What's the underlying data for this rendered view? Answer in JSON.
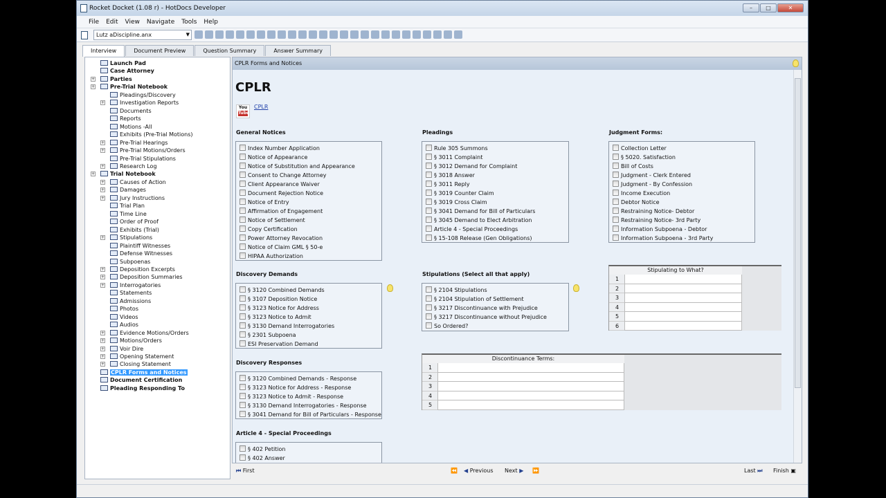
{
  "window": {
    "title": "Rocket Docket (1.08 r)  - HotDocs Developer"
  },
  "menu": [
    "File",
    "Edit",
    "View",
    "Navigate",
    "Tools",
    "Help"
  ],
  "toolbar": {
    "document": "Lutz aDiscipline.anx"
  },
  "tabs": [
    "Interview",
    "Document Preview",
    "Question Summary",
    "Answer Summary"
  ],
  "tree": [
    {
      "label": "Launch Pad",
      "level": 0,
      "bold": true
    },
    {
      "label": "Case Attorney",
      "level": 0,
      "bold": true
    },
    {
      "label": "Parties",
      "level": 0,
      "bold": true,
      "expand": true
    },
    {
      "label": "Pre-Trial Notebook",
      "level": 0,
      "bold": true,
      "expand": true
    },
    {
      "label": "Pleadings/Discovery",
      "level": 1
    },
    {
      "label": "Investigation Reports",
      "level": 1,
      "expand": true
    },
    {
      "label": "Documents",
      "level": 1
    },
    {
      "label": "Reports",
      "level": 1
    },
    {
      "label": "Motions -All",
      "level": 1
    },
    {
      "label": "Exhibits   (Pre-Trial Motions)",
      "level": 1
    },
    {
      "label": "Pre-Trial Hearings",
      "level": 1,
      "expand": true
    },
    {
      "label": "Pre-Trial Motions/Orders",
      "level": 1,
      "expand": true
    },
    {
      "label": "Pre-Trial Stipulations",
      "level": 1
    },
    {
      "label": "Research Log",
      "level": 1,
      "expand": true
    },
    {
      "label": "Trial Notebook",
      "level": 0,
      "bold": true,
      "expand": true
    },
    {
      "label": "Causes of Action",
      "level": 1,
      "expand": true
    },
    {
      "label": "Damages",
      "level": 1,
      "expand": true
    },
    {
      "label": "Jury Instructions",
      "level": 1,
      "expand": true
    },
    {
      "label": "Trial Plan",
      "level": 1
    },
    {
      "label": "Time Line",
      "level": 1
    },
    {
      "label": "Order of Proof",
      "level": 1
    },
    {
      "label": "Exhibits (Trial)",
      "level": 1
    },
    {
      "label": "Stipulations",
      "level": 1,
      "expand": true
    },
    {
      "label": "Plaintiff Witnesses",
      "level": 1
    },
    {
      "label": "Defense Witnesses",
      "level": 1
    },
    {
      "label": "Subpoenas",
      "level": 1
    },
    {
      "label": "Deposition Excerpts",
      "level": 1,
      "expand": true
    },
    {
      "label": "Deposition Summaries",
      "level": 1,
      "expand": true
    },
    {
      "label": "Interrogatories",
      "level": 1,
      "expand": true
    },
    {
      "label": "Statements",
      "level": 1
    },
    {
      "label": "Admissions",
      "level": 1
    },
    {
      "label": "Photos",
      "level": 1
    },
    {
      "label": "Videos",
      "level": 1
    },
    {
      "label": "Audios",
      "level": 1
    },
    {
      "label": "Evidence Motions/Orders",
      "level": 1,
      "expand": true
    },
    {
      "label": "Motions/Orders",
      "level": 1,
      "expand": true
    },
    {
      "label": "Voir Dire",
      "level": 1,
      "expand": true
    },
    {
      "label": "Opening Statement",
      "level": 1,
      "expand": true
    },
    {
      "label": "Closing Statement",
      "level": 1,
      "expand": true
    },
    {
      "label": "CPLR Forms and Notices",
      "level": 0,
      "bold": true,
      "selected": true
    },
    {
      "label": "Document Certification",
      "level": 0,
      "bold": true
    },
    {
      "label": "Pleading Responding To",
      "level": 0,
      "bold": true
    }
  ],
  "content": {
    "header": "CPLR Forms and Notices",
    "title": "CPLR",
    "link": "CPLR",
    "youtube_icon": {
      "top": "You",
      "bottom": "Tube"
    },
    "sections": [
      {
        "id": "general",
        "title": "General Notices",
        "items": [
          "Index Number Application",
          "Notice of Appearance",
          "Notice of Substitution and Appearance",
          "Consent to Change Attorney",
          "Client Appearance Waiver",
          "Document Rejection Notice",
          "Notice of Entry",
          "Affirmation of Engagement",
          "Notice of Settlement",
          "Copy Certification",
          "Power Attorney Revocation",
          "Notice of Claim GML § 50-e",
          "HIPAA Authorization"
        ]
      },
      {
        "id": "pleadings",
        "title": "Pleadings",
        "items": [
          "Rule 305 Summons",
          "§ 3011 Complaint",
          "§ 3012 Demand for Complaint",
          "§ 3018 Answer",
          "§ 3011 Reply",
          "§ 3019 Counter Claim",
          "§ 3019 Cross Claim",
          "§ 3041 Demand for Bill of Particulars",
          "§ 3045 Demand to Elect Arbitration",
          "Article 4 - Special Proceedings",
          "§ 15-108 Release (Gen Obligations)"
        ]
      },
      {
        "id": "judgment",
        "title": "Judgment Forms:",
        "items": [
          "Collection Letter",
          "§ 5020. Satisfaction",
          "Bill of Costs",
          "Judgment - Clerk Entered",
          "Judgment - By Confession",
          "Income Execution",
          "Debtor Notice",
          "Restraining Notice- Debtor",
          "Restraining Notice- 3rd Party",
          "Information Subpoena - Debtor",
          "Information Subpoena - 3rd Party"
        ]
      },
      {
        "id": "discdem",
        "title": "Discovery Demands",
        "items": [
          "§ 3120 Combined Demands",
          "§ 3107 Deposition Notice",
          "§ 3123 Notice for Address",
          "§ 3123 Notice to Admit",
          "§ 3130 Demand Interrogatories",
          "§ 2301 Subpoena",
          "ESI Preservation Demand"
        ]
      },
      {
        "id": "stips",
        "title": "Stipulations (Select all that apply)",
        "items": [
          "§ 2104 Stipulations",
          "§ 2104 Stipulation of Settlement",
          "§ 3217 Discontinuance with Prejudice",
          "§ 3217 Discontinuance without Prejudice",
          "So Ordered?"
        ]
      },
      {
        "id": "discresp",
        "title": "Discovery Responses",
        "items": [
          "§ 3120 Combined Demands - Response",
          "§ 3123 Notice for Address - Response",
          "§ 3123 Notice to Admit - Response",
          "§ 3130 Demand Interrogatories - Response",
          "§ 3041 Demand for Bill of Particulars - Response"
        ]
      },
      {
        "id": "art4",
        "title": "Article 4 - Special Proceedings",
        "items": [
          "§ 402 Petition",
          "§ 402 Answer"
        ]
      }
    ],
    "grids": [
      {
        "id": "stipulating",
        "header": "Stipulating to What?",
        "rows": [
          "1",
          "2",
          "3",
          "4",
          "5",
          "6"
        ]
      },
      {
        "id": "discontinuance",
        "header": "Discontinuance Terms:",
        "rows": [
          "1",
          "2",
          "3",
          "4",
          "5"
        ]
      }
    ]
  },
  "nav": {
    "first": "First",
    "previous": "Previous",
    "next": "Next",
    "last": "Last",
    "finish": "Finish"
  }
}
